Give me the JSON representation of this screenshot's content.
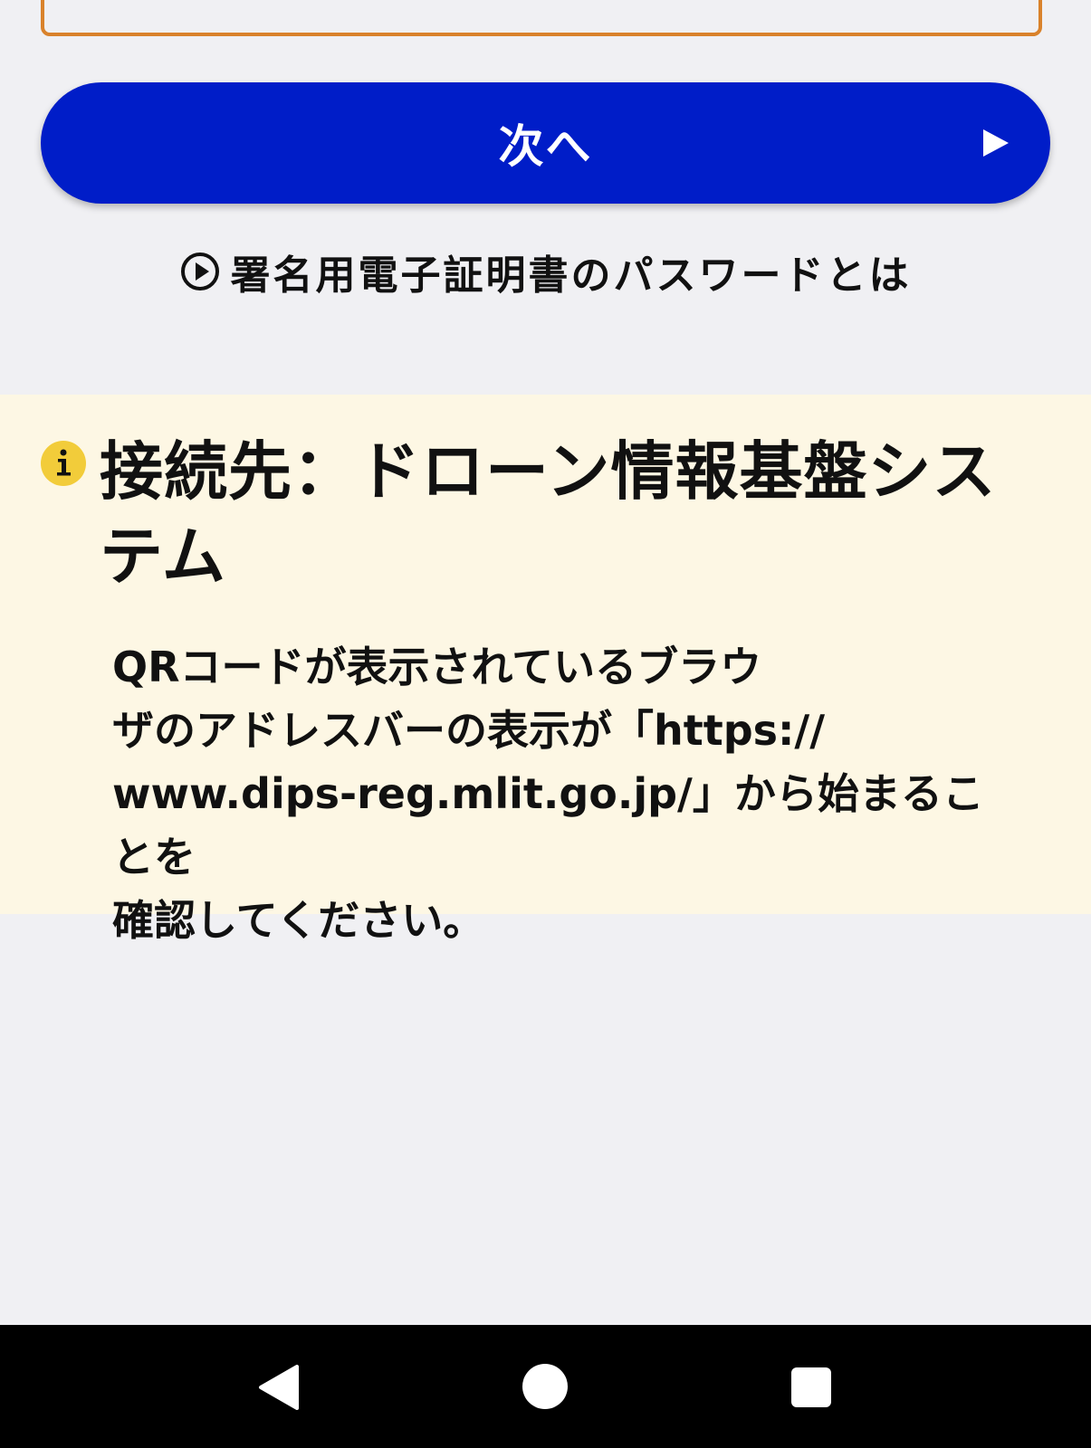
{
  "form": {
    "password_input_value": ""
  },
  "next_button": {
    "label": "次へ",
    "arrow_icon": "play-arrow-icon"
  },
  "help_link": {
    "icon": "circle-play-icon",
    "label": "署名用電子証明書のパスワードとは"
  },
  "info_panel": {
    "icon": "info-icon",
    "title": "接続先：ドローン情報基盤システム",
    "body_lines": [
      "QRコードが表示されているブラウ",
      "ザのアドレスバーの表示が「https://",
      "www.dips-reg.mlit.go.jp/」から始まることを",
      "確認してください。"
    ]
  },
  "system_nav": {
    "back_icon": "back-triangle-icon",
    "home_icon": "home-circle-icon",
    "recents_icon": "recents-square-icon"
  },
  "colors": {
    "primary_button": "#001dc8",
    "input_border": "#d9822b",
    "info_background": "#fdf7e4",
    "info_icon": "#f2cc3a",
    "page_background": "#f0f0f3"
  }
}
